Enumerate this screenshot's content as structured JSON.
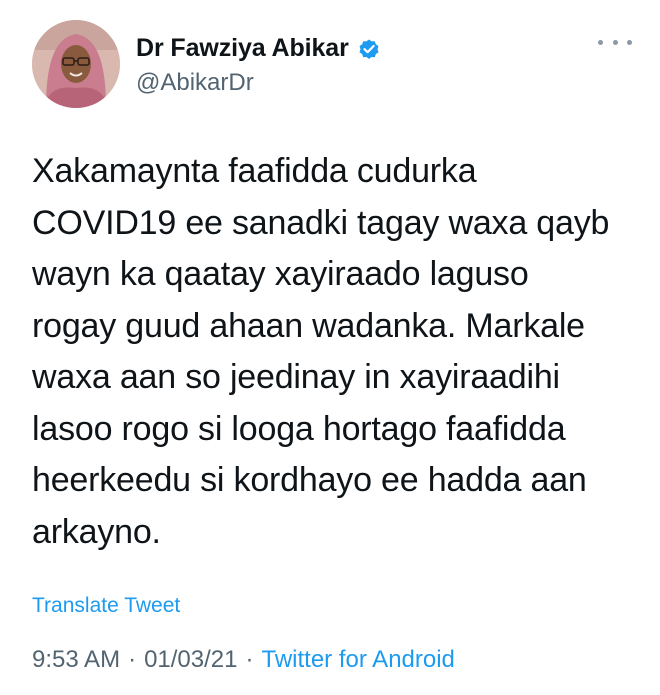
{
  "author": {
    "display_name": "Dr Fawziya Abikar",
    "handle": "@AbikarDr",
    "avatar_icon": "profile-photo-avatar",
    "verified_icon": "verified-badge-icon"
  },
  "tweet": {
    "text": "Xakamaynta faafidda cudurka\nCOVID19 ee sanadki tagay waxa qayb\nwayn ka qaatay xayiraado laguso\nrogay guud ahaan wadanka. Markale\nwaxa aan so jeedinay in xayiraadihi\nlasoo rogo si looga hortago faafidda\nheerkeedu si kordhayo ee hadda aan\narkayno.",
    "translate_label": "Translate Tweet",
    "time": "9:53 AM",
    "separator": "·",
    "date": "01/03/21",
    "source": "Twitter for Android"
  },
  "colors": {
    "accent": "#1d9bf0",
    "secondary_text": "#536471",
    "primary_text": "#0f1419"
  }
}
